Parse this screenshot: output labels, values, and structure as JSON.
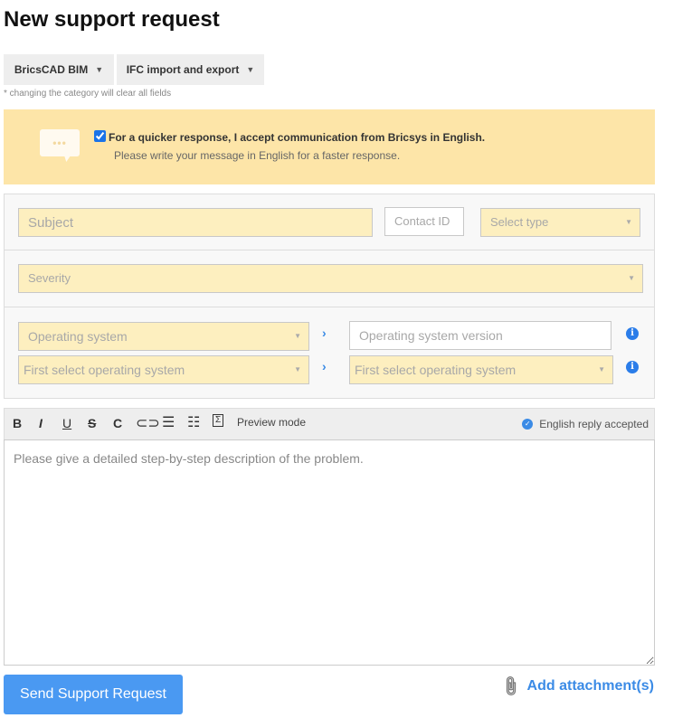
{
  "page": {
    "title": "New support request"
  },
  "categories": {
    "product": "BricsCAD BIM",
    "topic": "IFC import and export",
    "note": "* changing the category will clear all fields"
  },
  "banner": {
    "checkbox_checked": true,
    "accept_label": "For a quicker response, I accept communication from Bricsys in English.",
    "hint": "Please write your message in English for a faster response.",
    "icon": "speech-bubble-icon"
  },
  "form": {
    "subject_placeholder": "Subject",
    "contact_id_placeholder": "Contact ID",
    "type_placeholder": "Select type",
    "severity_placeholder": "Severity",
    "os_placeholder": "Operating system",
    "os_version_placeholder": "Operating system version",
    "os_sub1_placeholder": "First select operating system",
    "os_sub2_placeholder": "First select operating system"
  },
  "editor": {
    "tools": [
      "B",
      "I",
      "U",
      "S",
      "C",
      "link",
      "bulleted-list",
      "numbered-list",
      "code"
    ],
    "preview_label": "Preview mode",
    "english_status": "English reply accepted",
    "description_placeholder": "Please give a detailed step-by-step description of the problem."
  },
  "actions": {
    "send_label": "Send Support Request",
    "attach_label": "Add attachment(s)"
  },
  "colors": {
    "accent": "#4a99f2",
    "banner": "#fde5a8",
    "required_field": "#fdefbf"
  }
}
